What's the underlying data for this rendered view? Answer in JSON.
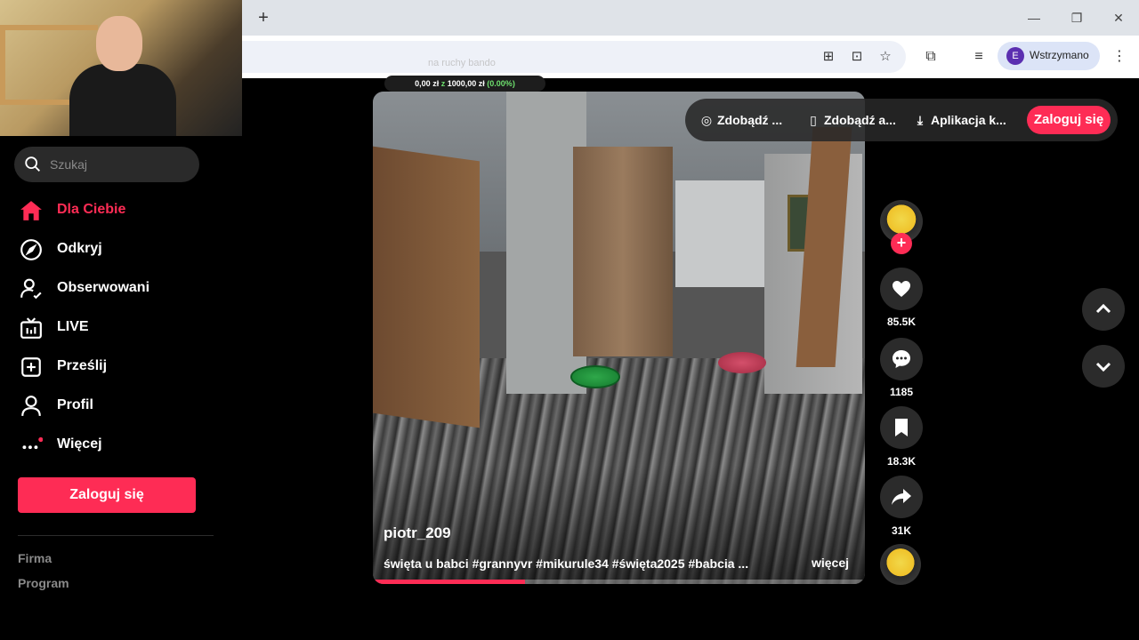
{
  "browser": {
    "profile_initial": "E",
    "profile_label": "Wstrzymano",
    "new_tab_icon": "plus-icon"
  },
  "overlay": {
    "title": "na ruchy bando",
    "amount_prefix": "0,00 zł",
    "amount_sep": "z",
    "amount_goal": "1000,00 zł",
    "amount_pct": "(0.00%)"
  },
  "sidebar": {
    "search_placeholder": "Szukaj",
    "items": [
      {
        "label": "Dla Ciebie",
        "icon": "home-icon",
        "active": true
      },
      {
        "label": "Odkryj",
        "icon": "compass-icon"
      },
      {
        "label": "Obserwowani",
        "icon": "following-icon"
      },
      {
        "label": "LIVE",
        "icon": "live-tv-icon"
      },
      {
        "label": "Prześlij",
        "icon": "upload-icon"
      },
      {
        "label": "Profil",
        "icon": "profile-icon"
      },
      {
        "label": "Więcej",
        "icon": "more-dots-icon"
      }
    ],
    "login_label": "Zaloguj się",
    "footer": [
      "Firma",
      "Program"
    ]
  },
  "topbar": {
    "items": [
      {
        "label": "Zdobądź ...",
        "icon": "coin-icon"
      },
      {
        "label": "Zdobądź a...",
        "icon": "phone-icon"
      },
      {
        "label": "Aplikacja k...",
        "icon": "download-icon"
      }
    ],
    "login_label": "Zaloguj się"
  },
  "video": {
    "author": "piotr_209",
    "caption": "święta u babci #grannyvr #mikurule34 #święta2025 #babcia ...",
    "more_label": "więcej",
    "progress": 0.31
  },
  "actions": {
    "likes": "85.5K",
    "comments": "1185",
    "saves": "18.3K",
    "shares": "31K"
  },
  "colors": {
    "accent": "#fe2c55",
    "background": "#000000"
  }
}
